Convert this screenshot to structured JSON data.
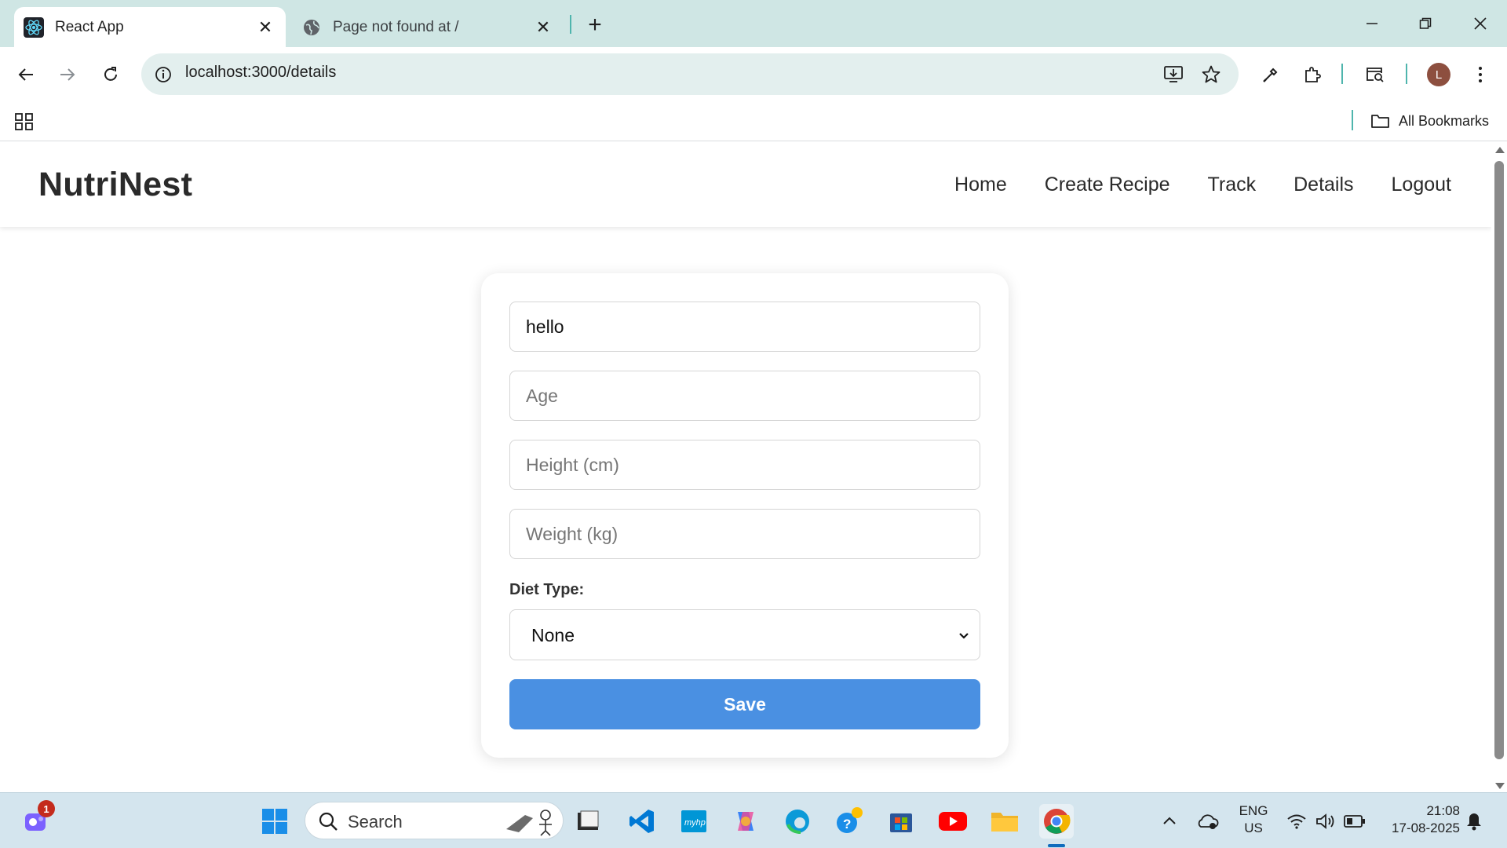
{
  "browser": {
    "tabs": [
      {
        "title": "React App",
        "active": true
      },
      {
        "title": "Page not found at /",
        "active": false
      }
    ],
    "url": "localhost:3000/details",
    "bookmarks_label": "All Bookmarks",
    "profile_initial": "L"
  },
  "app": {
    "brand": "NutriNest",
    "nav": [
      "Home",
      "Create Recipe",
      "Track",
      "Details",
      "Logout"
    ]
  },
  "form": {
    "name_value": "hello",
    "age_placeholder": "Age",
    "height_placeholder": "Height (cm)",
    "weight_placeholder": "Weight (kg)",
    "diet_label": "Diet Type:",
    "diet_selected": "None",
    "save_label": "Save"
  },
  "taskbar": {
    "search_label": "Search",
    "notification_count": "1",
    "lang_line1": "ENG",
    "lang_line2": "US",
    "time": "21:08",
    "date": "17-08-2025"
  },
  "colors": {
    "accent": "#4a90e2",
    "chrome_tabbar": "#cfe6e4"
  }
}
